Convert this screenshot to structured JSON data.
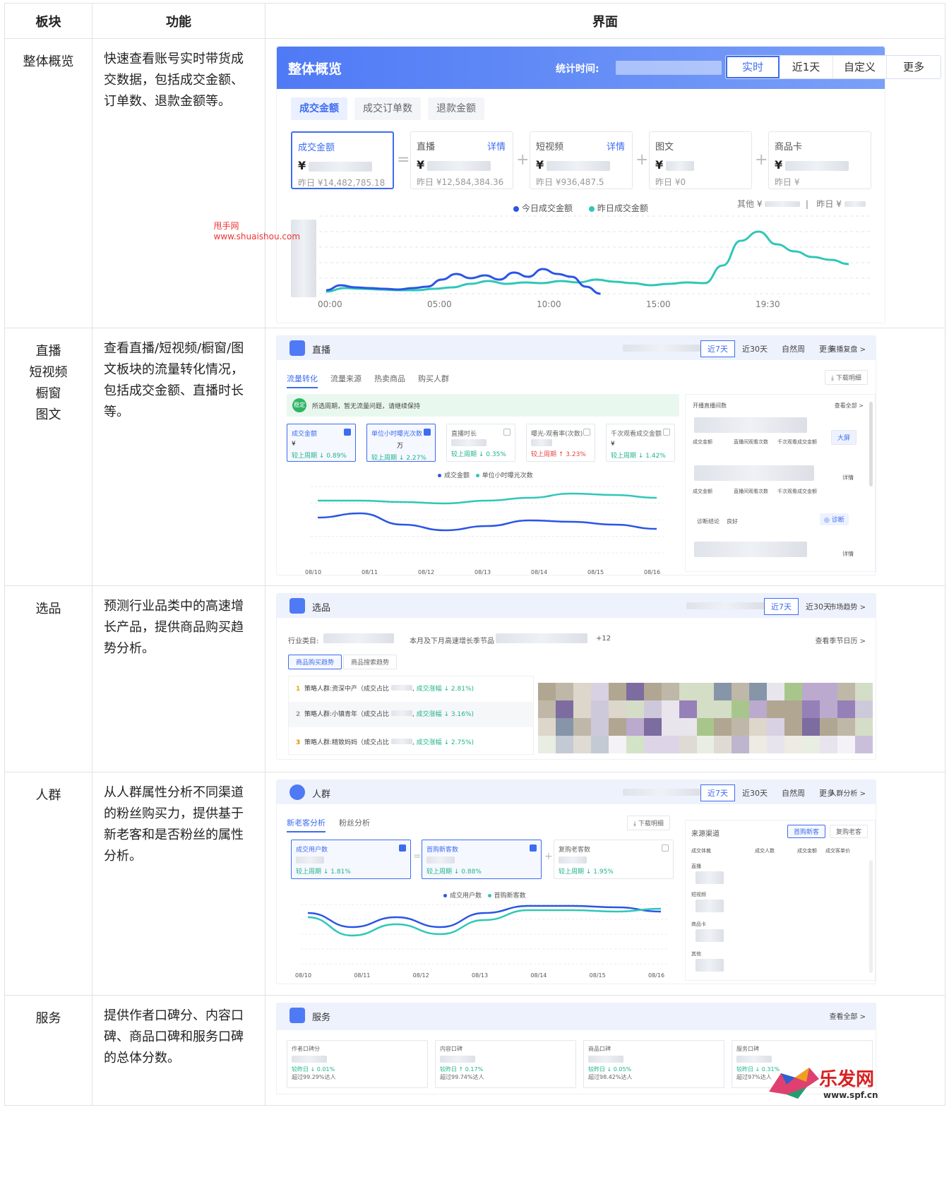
{
  "table": {
    "headers": [
      "板块",
      "功能",
      "界面"
    ],
    "rows": [
      {
        "block": "整体概览",
        "desc": "快速查看账号实时带货成交数据，包括成交金额、订单数、退款金额等。"
      },
      {
        "block_lines": [
          "直播",
          "短视频",
          "橱窗",
          "图文"
        ],
        "desc": "查看直播/短视频/橱窗/图文板块的流量转化情况，包括成交金额、直播时长等。"
      },
      {
        "block": "选品",
        "desc": "预测行业品类中的高速增长产品，提供商品购买趋势分析。"
      },
      {
        "block": "人群",
        "desc": "从人群属性分析不同渠道的粉丝购买力，提供基于新老客和是否粉丝的属性分析。"
      },
      {
        "block": "服务",
        "desc": "提供作者口碑分、内容口碑、商品口碑和服务口碑的总体分数。"
      }
    ]
  },
  "overview": {
    "title": "整体概览",
    "stat_label": "统计时间:",
    "segments": [
      "实时",
      "近1天",
      "自定义",
      "更多"
    ],
    "tabs": [
      "成交金额",
      "成交订单数",
      "退款金额"
    ],
    "cards": [
      {
        "label": "成交金额",
        "prefix": "¥",
        "prev": "昨日 ¥14,482,785.18"
      },
      {
        "label": "直播",
        "prefix": "¥",
        "prev": "昨日 ¥12,584,384.36",
        "detail": "详情"
      },
      {
        "label": "短视频",
        "prefix": "¥",
        "prev": "昨日 ¥936,487.5",
        "detail": "详情"
      },
      {
        "label": "图文",
        "prefix": "¥",
        "prev": "昨日 ¥0"
      },
      {
        "label": "商品卡",
        "prefix": "¥",
        "prev": "昨日 ¥"
      }
    ],
    "ops": [
      "=",
      "+",
      "+",
      "+"
    ],
    "legend": {
      "today": "今日成交金额",
      "yesterday": "昨日成交金额"
    },
    "other": "其他 ¥",
    "other_prev": "昨日 ¥",
    "colors": {
      "today": "#2a55e5",
      "yesterday": "#2fc7b8"
    }
  },
  "chart_data": {
    "type": "line",
    "x": [
      "00:00",
      "05:00",
      "10:00",
      "15:00",
      "19:30"
    ],
    "series": [
      {
        "name": "今日成交金额",
        "values": [
          5,
          12,
          9,
          8,
          7,
          6,
          8,
          10,
          20,
          28,
          22,
          26,
          20,
          30,
          24,
          35,
          28,
          24,
          10,
          0
        ]
      },
      {
        "name": "昨日成交金额",
        "values": [
          3,
          8,
          7,
          6,
          5,
          5,
          7,
          9,
          14,
          18,
          14,
          16,
          15,
          18,
          16,
          20,
          17,
          15,
          12,
          14,
          16,
          15,
          40,
          75,
          88,
          70,
          60,
          52,
          48,
          42
        ]
      }
    ]
  },
  "live": {
    "name": "直播",
    "segments": [
      "近7天",
      "近30天",
      "自然周",
      "更多"
    ],
    "more": "直播复盘 >",
    "tabs": [
      "流量转化",
      "流量来源",
      "热卖商品",
      "购买人群"
    ],
    "download": "⤓ 下载明细",
    "notice": "所选周期，暂无流量问题，请继续保持",
    "badge": "稳定",
    "metrics": [
      {
        "label": "成交金额",
        "val": "¥",
        "cmp": "较上周期 ↓ 0.89%"
      },
      {
        "label": "单位小时曝光次数",
        "val": "万",
        "cmp": "较上周期 ↓ 2.27%"
      },
      {
        "label": "直播时长",
        "val": "",
        "cmp": "较上周期 ↓ 0.35%"
      },
      {
        "label": "曝光-观看率(次数)",
        "val": "",
        "cmp": "较上周期 ↑ 3.23%"
      },
      {
        "label": "千次观看成交金额",
        "val": "¥",
        "cmp": "较上周期 ↓ 1.42%"
      }
    ],
    "legend": [
      "成交金额",
      "单位小时曝光次数"
    ],
    "dates": [
      "08/10",
      "08/11",
      "08/12",
      "08/13",
      "08/14",
      "08/15",
      "08/16"
    ],
    "side_title": "开播直播间数",
    "side_all": "查看全部 >",
    "side_cols": [
      "成交金额",
      "直播间观看次数",
      "千次观看成交金额"
    ],
    "big": "大屏",
    "detail": "详情",
    "diag_label": "诊断结论",
    "diag_val": "良好",
    "diag_btn": "◎ 诊断"
  },
  "pick": {
    "name": "选品",
    "segments": [
      "近7天",
      "近30天"
    ],
    "more": "市场趋势 >",
    "cat": "行业类目:",
    "season": "本月及下月高速增长季节品",
    "plus": "+12",
    "season_link": "查看季节日历 >",
    "tabs": [
      "商品购买趋势",
      "商品搜索趋势"
    ],
    "rows": [
      {
        "rank": "1",
        "text": "策略人群:资深中产（成交占比",
        "gain": "成交涨幅 ↓ 2.81%)"
      },
      {
        "rank": "2",
        "text": "策略人群:小镇青年（成交占比",
        "gain": "成交涨幅 ↓ 3.16%)"
      },
      {
        "rank": "3",
        "text": "策略人群:精致妈妈（成交占比",
        "gain": "成交涨幅 ↓ 2.75%)"
      }
    ]
  },
  "crowd": {
    "name": "人群",
    "segments": [
      "近7天",
      "近30天",
      "自然周",
      "更多"
    ],
    "more": "人群分析 >",
    "tabs": [
      "新老客分析",
      "粉丝分析"
    ],
    "download": "⤓ 下载明细",
    "metrics": [
      {
        "label": "成交用户数",
        "cmp": "较上周期 ↓ 1.81%"
      },
      {
        "label": "首购新客数",
        "cmp": "较上周期 ↓ 0.88%"
      },
      {
        "label": "复购老客数",
        "cmp": "较上周期 ↓ 1.95%"
      }
    ],
    "legend": [
      "成交用户数",
      "首购新客数"
    ],
    "dates": [
      "08/10",
      "08/11",
      "08/12",
      "08/13",
      "08/14",
      "08/15",
      "08/16"
    ],
    "side_title": "来源渠道",
    "side_tabs": [
      "首购新客",
      "复购老客"
    ],
    "side_cols": [
      "成交体裁",
      "成交人数",
      "成交金额",
      "成交客单价"
    ],
    "side_rows": [
      "直播",
      "短视频",
      "商品卡",
      "其他"
    ]
  },
  "service": {
    "name": "服务",
    "more": "查看全部 >",
    "cards": [
      {
        "label": "作者口碑分",
        "a": "较昨日 ↓ 0.01%",
        "b": "超过99.29%达人"
      },
      {
        "label": "内容口碑",
        "a": "较昨日 ↑ 0.17%",
        "b": "超过99.74%达人"
      },
      {
        "label": "商品口碑",
        "a": "较昨日 ↓ 0.05%",
        "b": "超过98.42%达人"
      },
      {
        "label": "服务口碑",
        "a": "较昨日 ↓ 0.31%",
        "b": "超过97%达人"
      }
    ]
  },
  "watermark": {
    "line1": "甩手网",
    "line2": "www.shuaishou.com",
    "logo": "乐发网",
    "logo_url": "www.spf.cn"
  }
}
